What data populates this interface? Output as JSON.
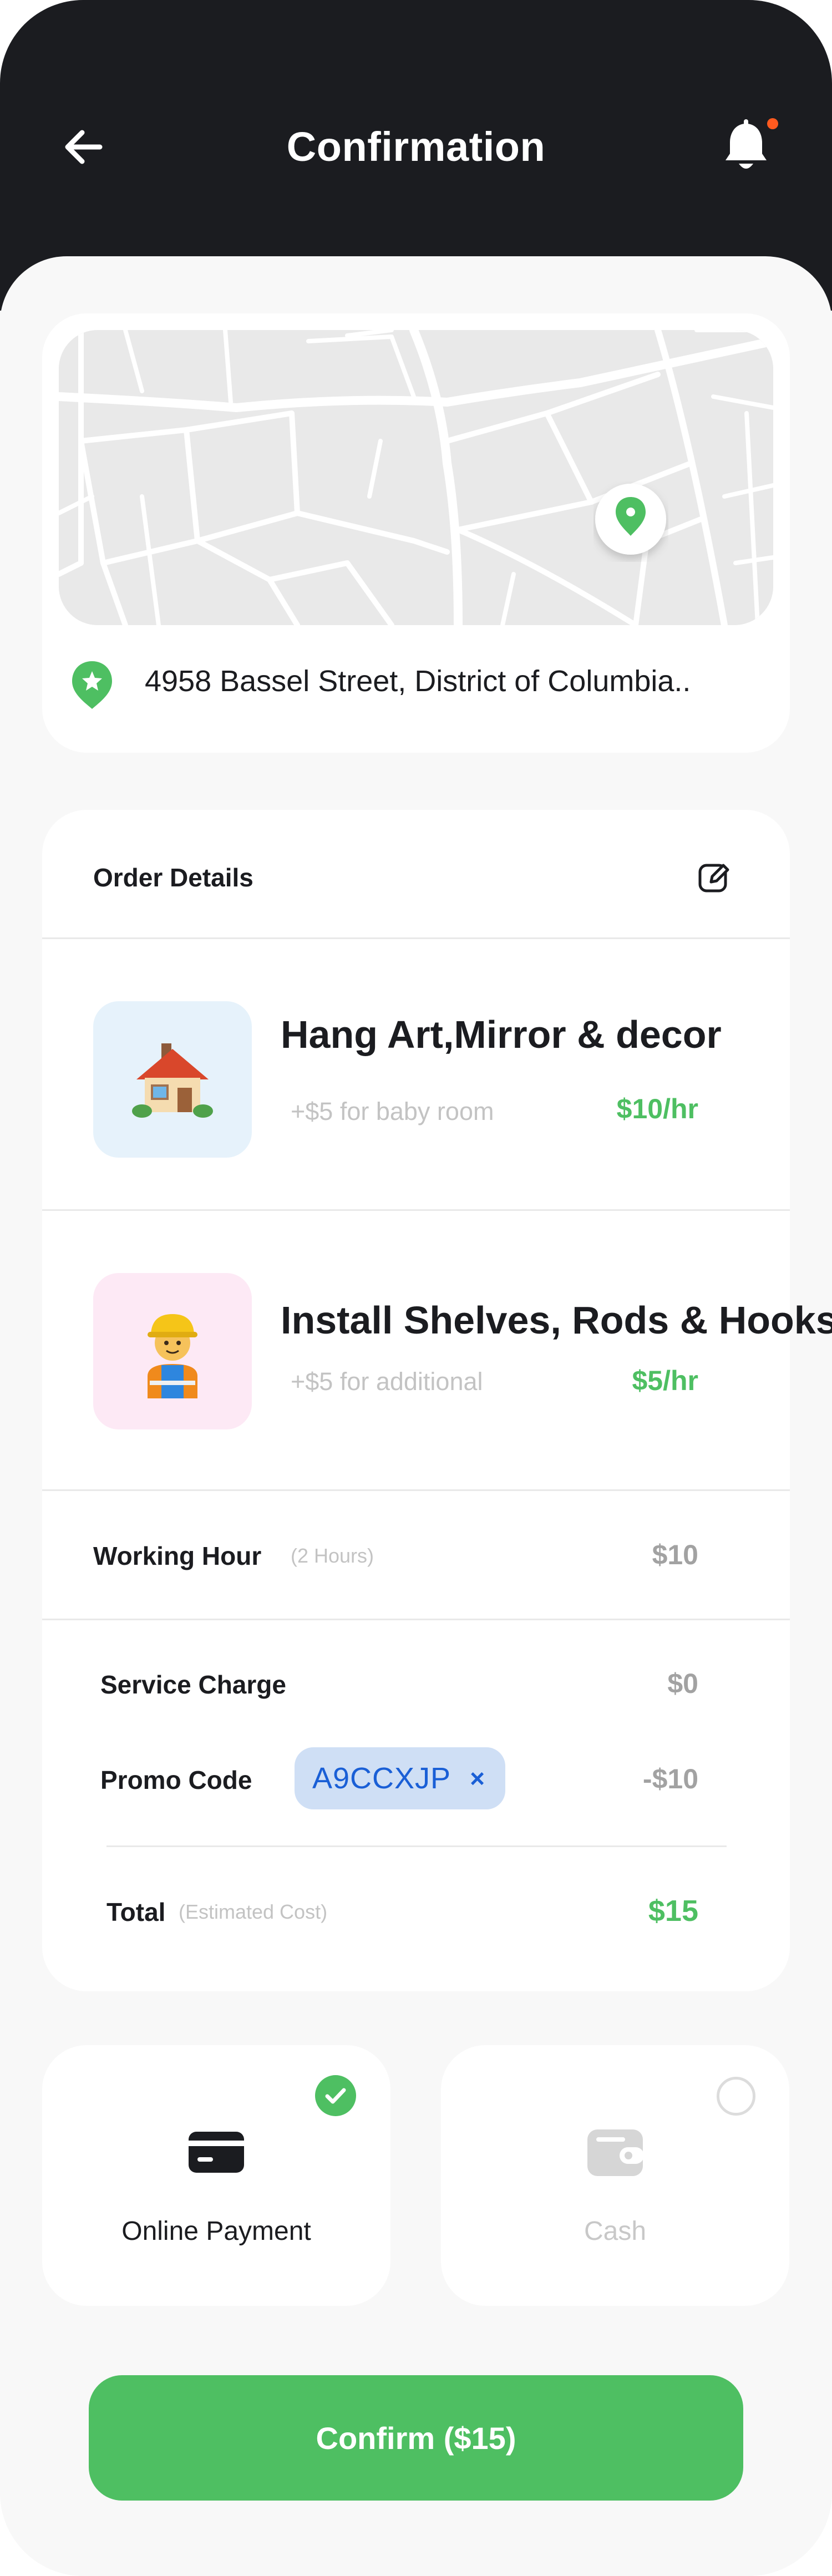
{
  "header": {
    "title": "Confirmation",
    "back_icon": "arrow-left-icon",
    "bell_icon": "bell-icon",
    "notification_dot_color": "#ff5a1f",
    "background_color": "#1b1c20"
  },
  "location": {
    "address": "4958  Bassel Street, District of Columbia..",
    "pin_icon": "map-pin-icon",
    "address_icon": "star-pin-icon"
  },
  "order": {
    "title": "Order Details",
    "edit_icon": "edit-icon",
    "services": [
      {
        "name": "Hang Art,Mirror & decor",
        "note": "+$5 for baby room",
        "price": "$10/hr",
        "icon": "house-emoji",
        "thumb_color": "#e6f2fb"
      },
      {
        "name": "Install Shelves, Rods & Hooks",
        "note": "+$5 for additional",
        "price": "$5/hr",
        "icon": "construction-worker-emoji",
        "thumb_color": "#fde9f5"
      }
    ],
    "working_hour": {
      "label": "Working Hour",
      "sub": "(2 Hours)",
      "value": "$10"
    },
    "service_charge": {
      "label": "Service Charge",
      "value": "$0"
    },
    "promo": {
      "label": "Promo Code",
      "code": "A9CCXJP",
      "remove": "×",
      "value": "-$10"
    },
    "total": {
      "label": "Total",
      "sub": "(Estimated Cost)",
      "value": "$15"
    }
  },
  "payment": {
    "online": {
      "label": "Online Payment",
      "selected": true,
      "icon": "credit-card-icon"
    },
    "cash": {
      "label": "Cash",
      "selected": false,
      "icon": "wallet-icon"
    }
  },
  "confirm_label": "Confirm ($15)",
  "colors": {
    "accent": "#4ebf62",
    "promo_bg": "#cfdff5",
    "promo_text": "#1a5fd6"
  }
}
